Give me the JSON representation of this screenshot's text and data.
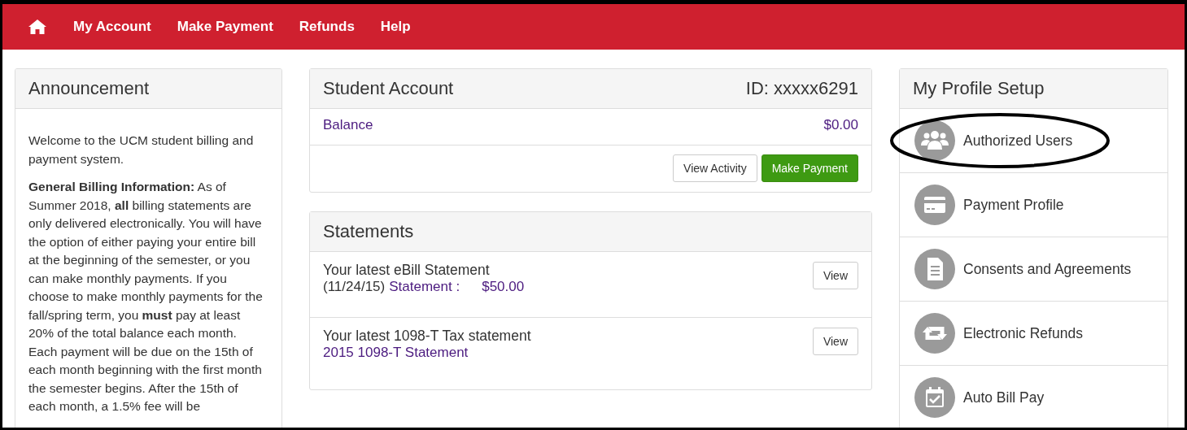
{
  "nav": {
    "items": [
      "My Account",
      "Make Payment",
      "Refunds",
      "Help"
    ]
  },
  "announcement": {
    "title": "Announcement",
    "paragraphs": [
      "Welcome to the UCM student billing and payment system.",
      "**General Billing Information:** As of Summer 2018, **all** billing statements are only delivered electronically. You will have the option of either paying your entire bill at the beginning of the semester, or you can make monthly payments. If you choose to make monthly payments for the fall/spring term, you **must** pay at least 20% of the total balance each month. Each payment will be due on the 15th of each month beginning with the first month the semester begins. After the 15th of each month, a 1.5% fee will be"
    ]
  },
  "student_account": {
    "title": "Student Account",
    "id": "ID: xxxxx6291",
    "balance_label": "Balance",
    "balance": "$0.00",
    "buttons": [
      {
        "label": "View Activity",
        "kind": "default"
      },
      {
        "label": "Make Payment",
        "kind": "primary"
      }
    ]
  },
  "statements": {
    "title": "Statements",
    "items": [
      {
        "heading": "Your latest eBill Statement",
        "date": "(11/24/15)",
        "link": "Statement :",
        "amount": "$50.00",
        "button": "View"
      },
      {
        "heading": "Your latest 1098-T Tax statement",
        "link": "2015 1098-T Statement",
        "button": "View"
      }
    ]
  },
  "profile": {
    "title": "My Profile Setup",
    "items": [
      {
        "label": "Authorized Users",
        "kind": "users",
        "highlighted": true
      },
      {
        "label": "Payment Profile",
        "kind": "card",
        "highlighted": false
      },
      {
        "label": "Consents and Agreements",
        "kind": "document",
        "highlighted": false
      },
      {
        "label": "Electronic Refunds",
        "kind": "refund",
        "highlighted": false
      },
      {
        "label": "Auto Bill Pay",
        "kind": "calendar",
        "highlighted": false
      }
    ]
  }
}
